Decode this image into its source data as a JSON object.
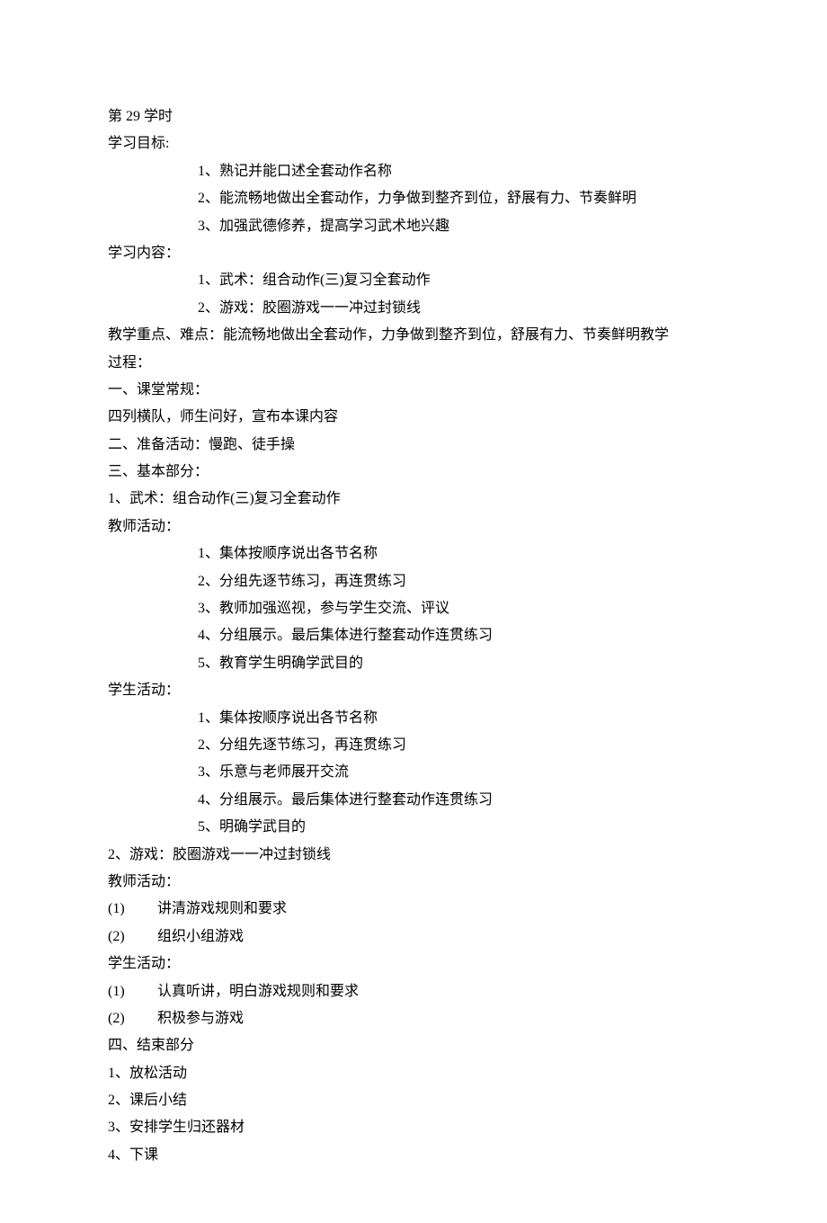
{
  "header": "第 29 学时",
  "objectives": {
    "label": "学习目标:",
    "items": [
      "1、熟记并能口述全套动作名称",
      "2、能流畅地做出全套动作，力争做到整齐到位，舒展有力、节奏鲜明",
      "3、加强武德修养，提高学习武术地兴趣"
    ]
  },
  "content": {
    "label": "学习内容：",
    "items": [
      "1、武术：组合动作(三)复习全套动作",
      "2、游戏：胶圈游戏一一冲过封锁线"
    ]
  },
  "key_points": {
    "line1": "教学重点、难点：能流畅地做出全套动作，力争做到整齐到位，舒展有力、节奏鲜明教学",
    "line2": "过程："
  },
  "section1": {
    "title": "一、课堂常规：",
    "body": "四列横队，师生问好，宣布本课内容"
  },
  "section2": {
    "title": "二、准备活动：慢跑、徒手操"
  },
  "section3": {
    "title": "三、基本部分：",
    "sub1": {
      "title": "1、武术：组合动作(三)复习全套动作",
      "teacher_label": "教师活动：",
      "teacher_items": [
        "1、集体按顺序说出各节名称",
        "2、分组先逐节练习，再连贯练习",
        "3、教师加强巡视，参与学生交流、评议",
        "4、分组展示。最后集体进行整套动作连贯练习",
        "5、教育学生明确学武目的"
      ],
      "student_label": "学生活动：",
      "student_items": [
        "1、集体按顺序说出各节名称",
        "2、分组先逐节练习，再连贯练习",
        "3、乐意与老师展开交流",
        "4、分组展示。最后集体进行整套动作连贯练习",
        "5、明确学武目的"
      ]
    },
    "sub2": {
      "title": "2、游戏：胶圈游戏一一冲过封锁线",
      "teacher_label": "教师活动：",
      "teacher_items": [
        {
          "num": "(1)",
          "text": "讲清游戏规则和要求"
        },
        {
          "num": "(2)",
          "text": "组织小组游戏"
        }
      ],
      "student_label": "学生活动：",
      "student_items": [
        {
          "num": "(1)",
          "text": "认真听讲，明白游戏规则和要求"
        },
        {
          "num": "(2)",
          "text": "积极参与游戏"
        }
      ]
    }
  },
  "section4": {
    "title": "四、结束部分",
    "items": [
      "1、放松活动",
      "2、课后小结",
      "3、安排学生归还器材",
      "4、下课"
    ]
  }
}
